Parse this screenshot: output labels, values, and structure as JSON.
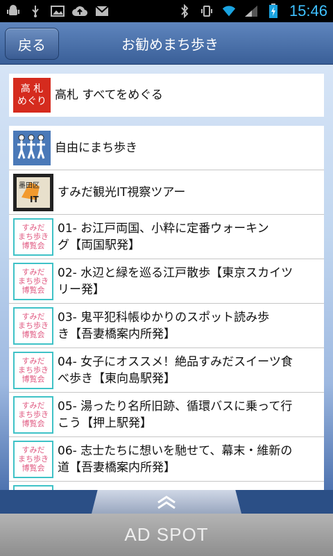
{
  "statusbar": {
    "time": "15:46"
  },
  "header": {
    "back_label": "戻る",
    "title": "お勧めまち歩き"
  },
  "top_item": {
    "label": "高札 すべてをめぐる",
    "thumb_line1": "高 札",
    "thumb_line2": "めぐり"
  },
  "items": [
    {
      "label_line1": "自由にまち歩き",
      "label_line2": ""
    },
    {
      "label_line1": "すみだ観光IT視察ツアー",
      "label_line2": "",
      "thumb_text_top": "墨田区",
      "thumb_text_bottom": "IT"
    },
    {
      "label_line1": "01- お江戸両国、小粋に定番ウォーキン",
      "label_line2": "グ【両国駅発】"
    },
    {
      "label_line1": "02- 水辺と緑を巡る江戸散歩【東京スカイツ",
      "label_line2": "リー発】"
    },
    {
      "label_line1": "03- 鬼平犯科帳ゆかりのスポット読み歩",
      "label_line2": "き【吾妻橋案内所発】"
    },
    {
      "label_line1": "04- 女子にオススメ！絶品すみだスイーツ食",
      "label_line2": "べ歩き【東向島駅発】"
    },
    {
      "label_line1": "05- 湯ったり名所旧跡、循環バスに乗って行",
      "label_line2": "こう【押上駅発】"
    },
    {
      "label_line1": "06- 志士たちに想いを馳せて、幕末・維新の",
      "label_line2": "道【吾妻橋案内所発】"
    }
  ],
  "sumida_thumb": {
    "line1": "すみだ",
    "line2": "まち歩き",
    "line3": "博覧会"
  },
  "footer": {
    "ad_label": "AD SPOT"
  },
  "colors": {
    "header": "#3a5f98",
    "accent_time": "#3fc0ff",
    "takafuda_red": "#d52b1e"
  }
}
